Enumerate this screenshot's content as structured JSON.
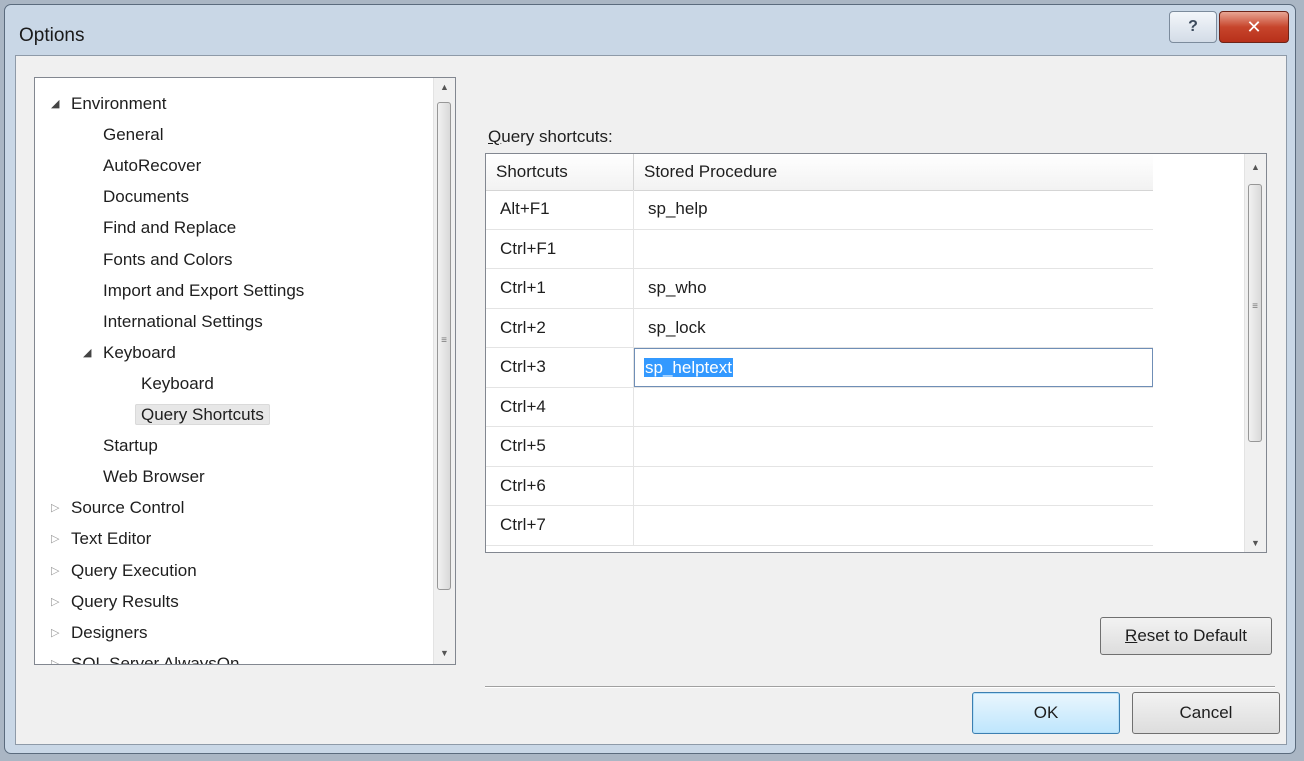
{
  "window": {
    "title": "Options",
    "help_glyph": "?",
    "close_glyph": "✕"
  },
  "tree": {
    "items": [
      {
        "label": "Environment",
        "level": 0,
        "arrow": "expanded"
      },
      {
        "label": "General",
        "level": 1
      },
      {
        "label": "AutoRecover",
        "level": 1
      },
      {
        "label": "Documents",
        "level": 1
      },
      {
        "label": "Find and Replace",
        "level": 1
      },
      {
        "label": "Fonts and Colors",
        "level": 1
      },
      {
        "label": "Import and Export Settings",
        "level": 1
      },
      {
        "label": "International Settings",
        "level": 1
      },
      {
        "label": "Keyboard",
        "level": 1,
        "arrow": "expanded"
      },
      {
        "label": "Keyboard",
        "level": 2
      },
      {
        "label": "Query Shortcuts",
        "level": 2,
        "selected": true
      },
      {
        "label": "Startup",
        "level": 1
      },
      {
        "label": "Web Browser",
        "level": 1
      },
      {
        "label": "Source Control",
        "level": 0,
        "arrow": "collapsed"
      },
      {
        "label": "Text Editor",
        "level": 0,
        "arrow": "collapsed"
      },
      {
        "label": "Query Execution",
        "level": 0,
        "arrow": "collapsed"
      },
      {
        "label": "Query Results",
        "level": 0,
        "arrow": "collapsed"
      },
      {
        "label": "Designers",
        "level": 0,
        "arrow": "collapsed"
      },
      {
        "label": "SQL Server AlwaysOn",
        "level": 0,
        "arrow": "collapsed"
      }
    ],
    "scroll_up": "▲",
    "scroll_down": "▼",
    "grip": "≡"
  },
  "query_shortcuts": {
    "label_accel": "Q",
    "label_rest": "uery shortcuts:",
    "columns": [
      "Shortcuts",
      "Stored Procedure"
    ],
    "rows": [
      {
        "shortcut": "Alt+F1",
        "procedure": "sp_help"
      },
      {
        "shortcut": "Ctrl+F1",
        "procedure": ""
      },
      {
        "shortcut": "Ctrl+1",
        "procedure": "sp_who"
      },
      {
        "shortcut": "Ctrl+2",
        "procedure": "sp_lock"
      },
      {
        "shortcut": "Ctrl+3",
        "procedure": "sp_helptext",
        "editing": true
      },
      {
        "shortcut": "Ctrl+4",
        "procedure": ""
      },
      {
        "shortcut": "Ctrl+5",
        "procedure": ""
      },
      {
        "shortcut": "Ctrl+6",
        "procedure": ""
      },
      {
        "shortcut": "Ctrl+7",
        "procedure": ""
      }
    ]
  },
  "buttons": {
    "reset_accel": "R",
    "reset_rest": "eset to Default",
    "ok": "OK",
    "cancel": "Cancel"
  }
}
